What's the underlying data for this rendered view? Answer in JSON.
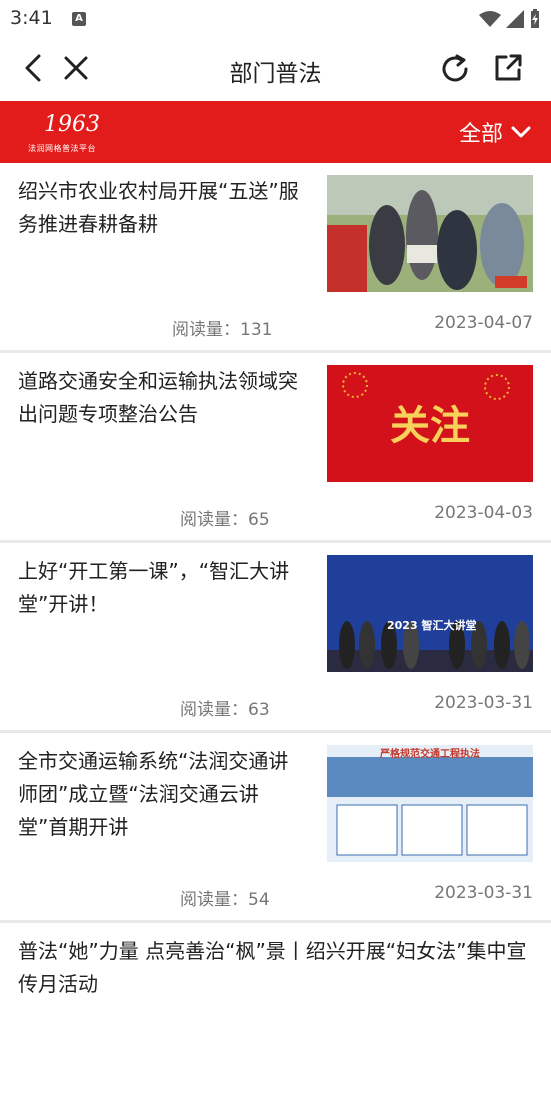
{
  "status": {
    "time": "3:41",
    "app_badge": "A"
  },
  "nav": {
    "title": "部门普法"
  },
  "banner": {
    "logo_mark": "1963",
    "logo_text": "法润网格普法平台",
    "filter_label": "全部"
  },
  "articles": [
    {
      "title": "绍兴市农业农村局开展“五送”服务推进春耕备耕",
      "reads": "阅读量：131",
      "date": "2023-04-07"
    },
    {
      "title": "道路交通安全和运输执法领域突出问题专项整治公告",
      "reads": "阅读量：65",
      "date": "2023-04-03",
      "thumb_text": "关注"
    },
    {
      "title": "上好“开工第一课”，“智汇大讲堂”开讲！",
      "reads": "阅读量：63",
      "date": "2023-03-31",
      "thumb_text": "2023 智汇大讲堂"
    },
    {
      "title": "全市交通运输系统“法润交通讲师团”成立暨“法润交通云讲堂”首期开讲",
      "reads": "阅读量：54",
      "date": "2023-03-31",
      "thumb_text": "严格规范交通工程执法"
    },
    {
      "title": "普法“她”力量 点亮善治“枫”景丨绍兴开展“妇女法”集中宣传月活动"
    }
  ],
  "colors": {
    "banner_red": "#e21c1a",
    "divider": "#e9e9e9"
  }
}
